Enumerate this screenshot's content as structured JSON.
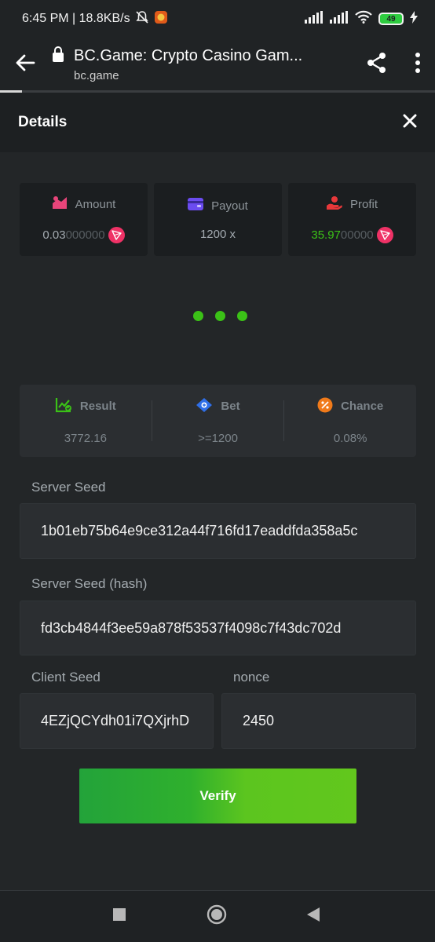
{
  "status_bar": {
    "left_text": "6:45 PM | 18.8KB/s",
    "battery": "49"
  },
  "browser": {
    "title": "BC.Game: Crypto Casino Gam...",
    "url": "bc.game"
  },
  "details": {
    "title": "Details"
  },
  "stats": {
    "amount": {
      "label": "Amount",
      "value_bright": "0.03",
      "value_dim": "000000"
    },
    "payout": {
      "label": "Payout",
      "value": "1200 x"
    },
    "profit": {
      "label": "Profit",
      "value_bright": "35.97",
      "value_dim": "00000"
    }
  },
  "result_panel": {
    "result": {
      "label": "Result",
      "value": "3772.16"
    },
    "bet": {
      "label": "Bet",
      "value": ">=1200"
    },
    "chance": {
      "label": "Chance",
      "value": "0.08%"
    }
  },
  "fields": {
    "server_seed": {
      "label": "Server Seed",
      "value": "1b01eb75b64e9ce312a44f716fd17eaddfda358a5c"
    },
    "server_seed_hash": {
      "label": "Server Seed (hash)",
      "value": "fd3cb4844f3ee59a878f53537f4098c7f43dc702d"
    },
    "client_seed": {
      "label": "Client Seed",
      "value": "4EZjQCYdh01i7QXjrhD"
    },
    "nonce": {
      "label": "nonce",
      "value": "2450"
    }
  },
  "verify_button": {
    "label": "Verify"
  },
  "colors": {
    "accent_green": "#3bc117",
    "tron_red": "#ef3266",
    "background": "#232628"
  }
}
